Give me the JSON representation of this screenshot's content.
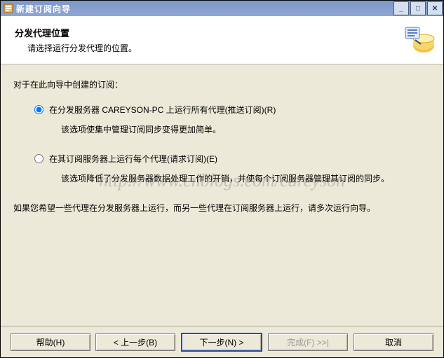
{
  "window": {
    "title": "新建订阅向导"
  },
  "header": {
    "title": "分发代理位置",
    "subtitle": "请选择运行分发代理的位置。"
  },
  "content": {
    "intro": "对于在此向导中创建的订阅：",
    "options": [
      {
        "label": "在分发服务器 CAREYSON-PC 上运行所有代理(推送订阅)(R)",
        "description": "该选项使集中管理订阅同步变得更加简单。",
        "selected": true
      },
      {
        "label": "在其订阅服务器上运行每个代理(请求订阅)(E)",
        "description": "该选项降低了分发服务器数据处理工作的开销，并使每个订阅服务器管理其订阅的同步。",
        "selected": false
      }
    ],
    "note": "如果您希望一些代理在分发服务器上运行，而另一些代理在订阅服务器上运行，请多次运行向导。"
  },
  "buttons": {
    "help": "帮助(H)",
    "back": "< 上一步(B)",
    "next": "下一步(N) >",
    "finish": "完成(F) >>|",
    "cancel": "取消"
  },
  "watermark": "http://www.cnblogs.com/careyson"
}
